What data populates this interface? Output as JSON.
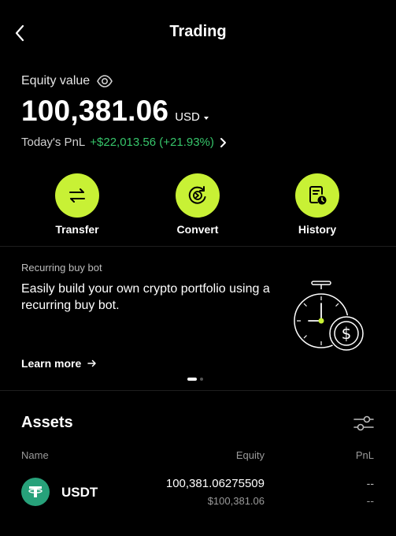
{
  "header": {
    "title": "Trading"
  },
  "equity": {
    "label": "Equity value",
    "value": "100,381.06",
    "currency": "USD"
  },
  "pnl": {
    "label": "Today's PnL",
    "value": "+$22,013.56 (+21.93%)"
  },
  "actions": [
    {
      "label": "Transfer",
      "icon": "transfer-icon"
    },
    {
      "label": "Convert",
      "icon": "convert-icon"
    },
    {
      "label": "History",
      "icon": "history-icon"
    }
  ],
  "promo": {
    "category": "Recurring buy bot",
    "text": "Easily build your own crypto portfolio using a recurring buy bot.",
    "link": "Learn more",
    "illustration": "stopwatch-dollar-icon",
    "pages": 2,
    "active_page": 1
  },
  "assets": {
    "title": "Assets",
    "columns": {
      "name": "Name",
      "equity": "Equity",
      "pnl": "PnL"
    },
    "rows": [
      {
        "symbol": "USDT",
        "icon": "tether-icon",
        "amount": "100,381.06275509",
        "usd": "$100,381.06",
        "pnl": "--",
        "pnl_pct": "--"
      }
    ]
  },
  "colors": {
    "accent": "#c8f135",
    "positive": "#36c46a",
    "background": "#000000",
    "tether": "#27a17a"
  }
}
